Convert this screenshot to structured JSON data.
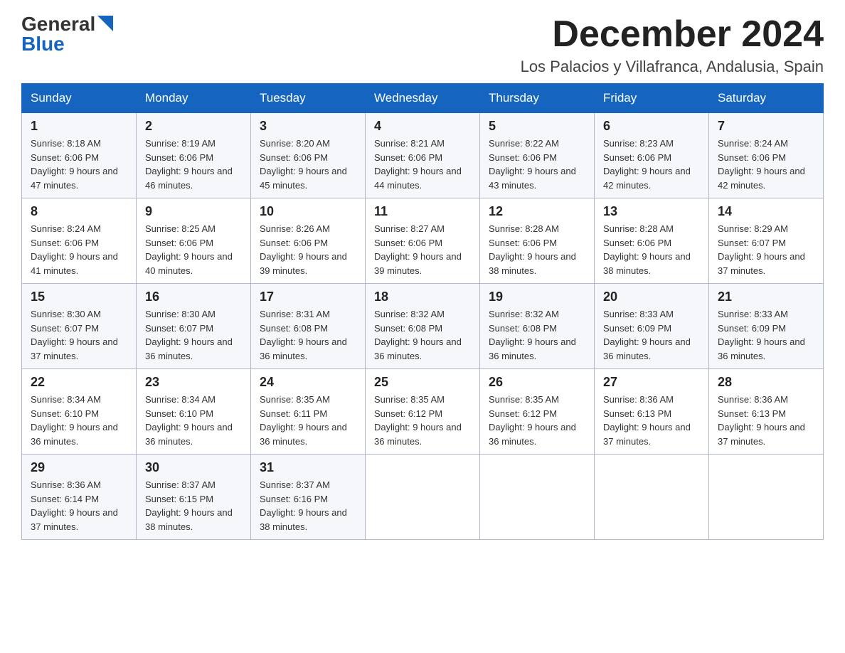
{
  "logo": {
    "general": "General",
    "blue": "Blue"
  },
  "title": {
    "month": "December 2024",
    "location": "Los Palacios y Villafranca, Andalusia, Spain"
  },
  "days_of_week": [
    "Sunday",
    "Monday",
    "Tuesday",
    "Wednesday",
    "Thursday",
    "Friday",
    "Saturday"
  ],
  "weeks": [
    [
      {
        "day": "1",
        "sunrise": "8:18 AM",
        "sunset": "6:06 PM",
        "daylight": "9 hours and 47 minutes."
      },
      {
        "day": "2",
        "sunrise": "8:19 AM",
        "sunset": "6:06 PM",
        "daylight": "9 hours and 46 minutes."
      },
      {
        "day": "3",
        "sunrise": "8:20 AM",
        "sunset": "6:06 PM",
        "daylight": "9 hours and 45 minutes."
      },
      {
        "day": "4",
        "sunrise": "8:21 AM",
        "sunset": "6:06 PM",
        "daylight": "9 hours and 44 minutes."
      },
      {
        "day": "5",
        "sunrise": "8:22 AM",
        "sunset": "6:06 PM",
        "daylight": "9 hours and 43 minutes."
      },
      {
        "day": "6",
        "sunrise": "8:23 AM",
        "sunset": "6:06 PM",
        "daylight": "9 hours and 42 minutes."
      },
      {
        "day": "7",
        "sunrise": "8:24 AM",
        "sunset": "6:06 PM",
        "daylight": "9 hours and 42 minutes."
      }
    ],
    [
      {
        "day": "8",
        "sunrise": "8:24 AM",
        "sunset": "6:06 PM",
        "daylight": "9 hours and 41 minutes."
      },
      {
        "day": "9",
        "sunrise": "8:25 AM",
        "sunset": "6:06 PM",
        "daylight": "9 hours and 40 minutes."
      },
      {
        "day": "10",
        "sunrise": "8:26 AM",
        "sunset": "6:06 PM",
        "daylight": "9 hours and 39 minutes."
      },
      {
        "day": "11",
        "sunrise": "8:27 AM",
        "sunset": "6:06 PM",
        "daylight": "9 hours and 39 minutes."
      },
      {
        "day": "12",
        "sunrise": "8:28 AM",
        "sunset": "6:06 PM",
        "daylight": "9 hours and 38 minutes."
      },
      {
        "day": "13",
        "sunrise": "8:28 AM",
        "sunset": "6:06 PM",
        "daylight": "9 hours and 38 minutes."
      },
      {
        "day": "14",
        "sunrise": "8:29 AM",
        "sunset": "6:07 PM",
        "daylight": "9 hours and 37 minutes."
      }
    ],
    [
      {
        "day": "15",
        "sunrise": "8:30 AM",
        "sunset": "6:07 PM",
        "daylight": "9 hours and 37 minutes."
      },
      {
        "day": "16",
        "sunrise": "8:30 AM",
        "sunset": "6:07 PM",
        "daylight": "9 hours and 36 minutes."
      },
      {
        "day": "17",
        "sunrise": "8:31 AM",
        "sunset": "6:08 PM",
        "daylight": "9 hours and 36 minutes."
      },
      {
        "day": "18",
        "sunrise": "8:32 AM",
        "sunset": "6:08 PM",
        "daylight": "9 hours and 36 minutes."
      },
      {
        "day": "19",
        "sunrise": "8:32 AM",
        "sunset": "6:08 PM",
        "daylight": "9 hours and 36 minutes."
      },
      {
        "day": "20",
        "sunrise": "8:33 AM",
        "sunset": "6:09 PM",
        "daylight": "9 hours and 36 minutes."
      },
      {
        "day": "21",
        "sunrise": "8:33 AM",
        "sunset": "6:09 PM",
        "daylight": "9 hours and 36 minutes."
      }
    ],
    [
      {
        "day": "22",
        "sunrise": "8:34 AM",
        "sunset": "6:10 PM",
        "daylight": "9 hours and 36 minutes."
      },
      {
        "day": "23",
        "sunrise": "8:34 AM",
        "sunset": "6:10 PM",
        "daylight": "9 hours and 36 minutes."
      },
      {
        "day": "24",
        "sunrise": "8:35 AM",
        "sunset": "6:11 PM",
        "daylight": "9 hours and 36 minutes."
      },
      {
        "day": "25",
        "sunrise": "8:35 AM",
        "sunset": "6:12 PM",
        "daylight": "9 hours and 36 minutes."
      },
      {
        "day": "26",
        "sunrise": "8:35 AM",
        "sunset": "6:12 PM",
        "daylight": "9 hours and 36 minutes."
      },
      {
        "day": "27",
        "sunrise": "8:36 AM",
        "sunset": "6:13 PM",
        "daylight": "9 hours and 37 minutes."
      },
      {
        "day": "28",
        "sunrise": "8:36 AM",
        "sunset": "6:13 PM",
        "daylight": "9 hours and 37 minutes."
      }
    ],
    [
      {
        "day": "29",
        "sunrise": "8:36 AM",
        "sunset": "6:14 PM",
        "daylight": "9 hours and 37 minutes."
      },
      {
        "day": "30",
        "sunrise": "8:37 AM",
        "sunset": "6:15 PM",
        "daylight": "9 hours and 38 minutes."
      },
      {
        "day": "31",
        "sunrise": "8:37 AM",
        "sunset": "6:16 PM",
        "daylight": "9 hours and 38 minutes."
      },
      null,
      null,
      null,
      null
    ]
  ]
}
